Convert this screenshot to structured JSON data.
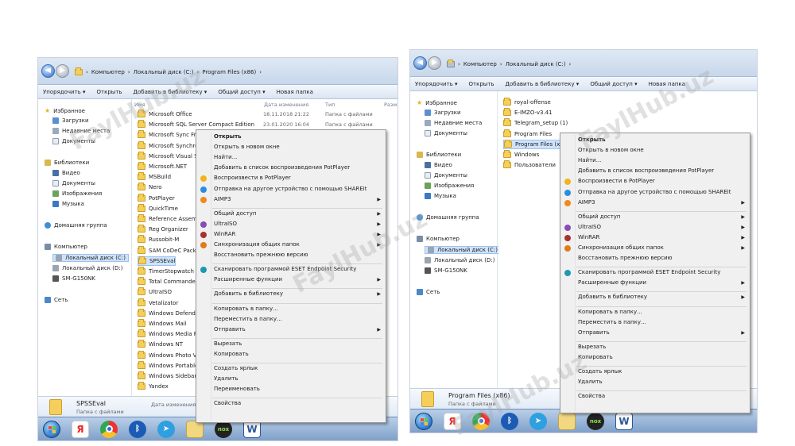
{
  "watermark": "FaylHub.uz",
  "left": {
    "breadcrumbs": [
      "Компьютер",
      "Локальный диск (C:)",
      "Program Files (x86)"
    ],
    "toolbar": [
      "Упорядочить ▾",
      "Открыть",
      "Добавить в библиотеку ▾",
      "Общий доступ ▾",
      "Новая папка"
    ],
    "nav": {
      "favorites": "Избранное",
      "downloads": "Загрузки",
      "recent": "Недавние места",
      "documents": "Документы",
      "libraries": "Библиотеки",
      "video": "Видео",
      "docs": "Документы",
      "images": "Изображения",
      "music": "Музыка",
      "homegroup": "Домашняя группа",
      "computer": "Компьютер",
      "diskC": "Локальный диск (C:)",
      "diskD": "Локальный диск (D:)",
      "phone": "SM-G150NK",
      "network": "Сеть"
    },
    "columns": [
      "Имя",
      "Дата изменения",
      "Тип",
      "Разм"
    ],
    "files": [
      "Microsoft Office",
      "Microsoft SQL Server Compact Edition",
      "Microsoft Sync Fram",
      "Microsoft Synchron",
      "Microsoft Visual Stu",
      "Microsoft.NET",
      "MSBuild",
      "Nero",
      "PotPlayer",
      "QuickTime",
      "Reference Assembli",
      "Reg Organizer",
      "Russobit-M",
      "SAM CoDeC Pack",
      "SPSSEval",
      "TimerStopwatch",
      "Total Commander",
      "UltraISO",
      "Vetalizator",
      "Windows Defender",
      "Windows Mail",
      "Windows Media Pla",
      "Windows NT",
      "Windows Photo Vie",
      "Windows Portable D",
      "Windows Sidebar",
      "Yandex"
    ],
    "row1_date": "18.11.2018 21:22",
    "row1_type": "Папка с файлами",
    "row2_date": "23.01.2020 16:04",
    "row2_type": "Папка с файлами",
    "status": {
      "name": "SPSSEval",
      "type": "Папка с файлами",
      "date": "Дата изменения: 27.11.20"
    },
    "menu": [
      {
        "t": "Открыть",
        "b": true
      },
      {
        "t": "Открыть в новом окне"
      },
      {
        "t": "Найти..."
      },
      {
        "t": "Добавить в список воспроизведения PotPlayer"
      },
      {
        "t": "Воспроизвести в PotPlayer"
      },
      {
        "t": "Отправка на другое устройство с помощью SHAREit"
      },
      {
        "t": "AIMP3",
        "a": true
      },
      {
        "sep": true
      },
      {
        "t": "Общий доступ",
        "a": true
      },
      {
        "t": "UltraISO",
        "a": true
      },
      {
        "t": "WinRAR",
        "a": true
      },
      {
        "t": "Синхронизация общих папок",
        "a": true
      },
      {
        "t": "Восстановить прежнюю версию"
      },
      {
        "sep": true
      },
      {
        "t": "Сканировать программой ESET Endpoint Security"
      },
      {
        "t": "Расширенные функции",
        "a": true
      },
      {
        "sep": true
      },
      {
        "t": "Добавить в библиотеку",
        "a": true
      },
      {
        "sep": true
      },
      {
        "t": "Копировать в папку..."
      },
      {
        "t": "Переместить в папку..."
      },
      {
        "t": "Отправить",
        "a": true
      },
      {
        "sep": true
      },
      {
        "t": "Вырезать"
      },
      {
        "t": "Копировать"
      },
      {
        "sep": true
      },
      {
        "t": "Создать ярлык"
      },
      {
        "t": "Удалить"
      },
      {
        "t": "Переименовать"
      },
      {
        "sep": true
      },
      {
        "t": "Свойства"
      }
    ]
  },
  "right": {
    "breadcrumbs": [
      "Компьютер",
      "Локальный диск (C:)"
    ],
    "toolbar": [
      "Упорядочить ▾",
      "Открыть",
      "Добавить в библиотеку ▾",
      "Общий доступ ▾",
      "Новая папка"
    ],
    "nav": {
      "favorites": "Избранное",
      "downloads": "Загрузки",
      "recent": "Недавние места",
      "documents": "Документы",
      "libraries": "Библиотеки",
      "video": "Видео",
      "docs": "Документы",
      "images": "Изображения",
      "music": "Музыка",
      "homegroup": "Домашняя группа",
      "computer": "Компьютер",
      "diskC": "Локальный диск (C:)",
      "diskD": "Локальный диск (D:)",
      "phone": "SM-G150NK",
      "network": "Сеть"
    },
    "files": [
      "royal-offense",
      "E-IMZO-v3.41",
      "Telegram_setup (1)",
      "Program Files",
      "Program Files (x86)",
      "Windows",
      "Пользователи"
    ],
    "status": {
      "name": "Program Files (x86)",
      "type": "Папка с файлами"
    },
    "menu": [
      {
        "t": "Открыть",
        "b": true
      },
      {
        "t": "Открыть в новом окне"
      },
      {
        "t": "Найти..."
      },
      {
        "t": "Добавить в список воспроизведения PotPlayer"
      },
      {
        "t": "Воспроизвести в PotPlayer"
      },
      {
        "t": "Отправка на другое устройство с помощью SHAREit"
      },
      {
        "t": "AIMP3",
        "a": true
      },
      {
        "sep": true
      },
      {
        "t": "Общий доступ",
        "a": true
      },
      {
        "t": "UltraISO",
        "a": true
      },
      {
        "t": "WinRAR",
        "a": true
      },
      {
        "t": "Синхронизация общих папок",
        "a": true
      },
      {
        "t": "Восстановить прежнюю версию"
      },
      {
        "sep": true
      },
      {
        "t": "Сканировать программой ESET Endpoint Security"
      },
      {
        "t": "Расширенные функции",
        "a": true
      },
      {
        "sep": true
      },
      {
        "t": "Добавить в библиотеку",
        "a": true
      },
      {
        "sep": true
      },
      {
        "t": "Копировать в папку..."
      },
      {
        "t": "Переместить в папку..."
      },
      {
        "t": "Отправить",
        "a": true
      },
      {
        "sep": true
      },
      {
        "t": "Вырезать"
      },
      {
        "t": "Копировать"
      },
      {
        "sep": true
      },
      {
        "t": "Создать ярлык"
      },
      {
        "t": "Удалить"
      },
      {
        "sep": true
      },
      {
        "t": "Свойства"
      }
    ]
  },
  "taskbar": [
    "start-icon",
    "yandex-icon",
    "chrome-icon",
    "bluetooth-icon",
    "telegram-icon",
    "explorer-icon",
    "nox-icon",
    "word-icon"
  ],
  "taskbar_glyphs": {
    "yandex": "Я",
    "bluetooth": "ᛒ",
    "telegram": "➤",
    "nox": "nox",
    "word": "W"
  }
}
